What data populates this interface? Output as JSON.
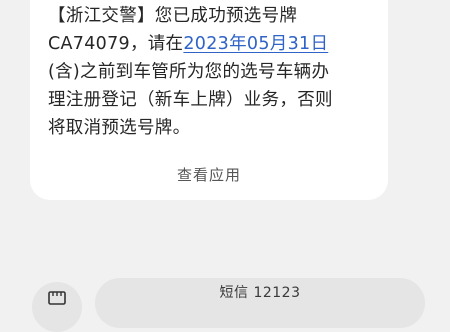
{
  "message": {
    "line1": "【浙江交警】您已成功预选号牌",
    "line2_prefix": "CA74079，请在",
    "date_link": "2023年05月31日",
    "line3": "(含)之前到车管所为您的选号车辆办",
    "line4": "理注册登记（新车上牌）业务，否则",
    "line5": "将取消预选号牌。",
    "link_color": "#2f63c7"
  },
  "actions": {
    "view_app_label": "查看应用"
  },
  "composer": {
    "sim_icon": "sim-card-icon",
    "placeholder": "短信 12123"
  }
}
